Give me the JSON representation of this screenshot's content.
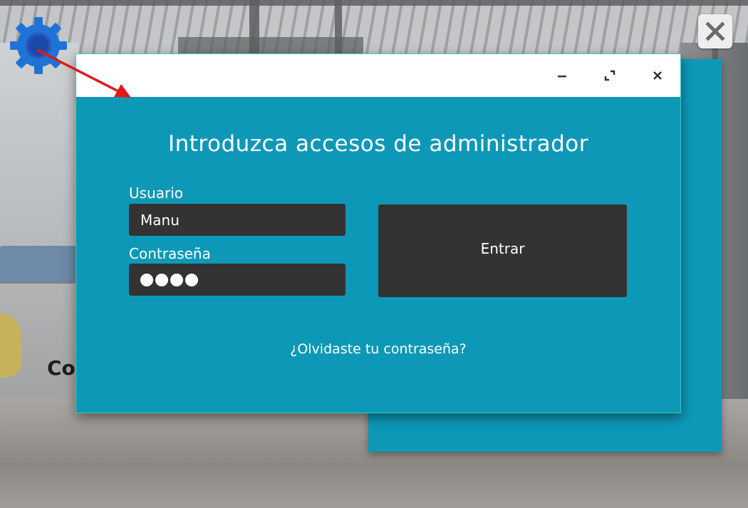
{
  "background": {
    "partial_text": "Co"
  },
  "dialog": {
    "heading": "Introduzca accesos de administrador",
    "username_label": "Usuario",
    "username_value": "Manu",
    "password_label": "Contraseña",
    "password_mask_count": 4,
    "enter_label": "Entrar",
    "forgot_link": "¿Olvidaste tu contraseña?"
  },
  "icons": {
    "settings": "gear-icon",
    "close_app": "close-icon",
    "minimize": "minimize-icon",
    "maximize": "maximize-icon",
    "close_dialog": "close-icon"
  },
  "colors": {
    "dialog_bg": "#0e98b7",
    "input_bg": "#333333",
    "gear": "#1f73d6",
    "arrow": "#e01818"
  }
}
